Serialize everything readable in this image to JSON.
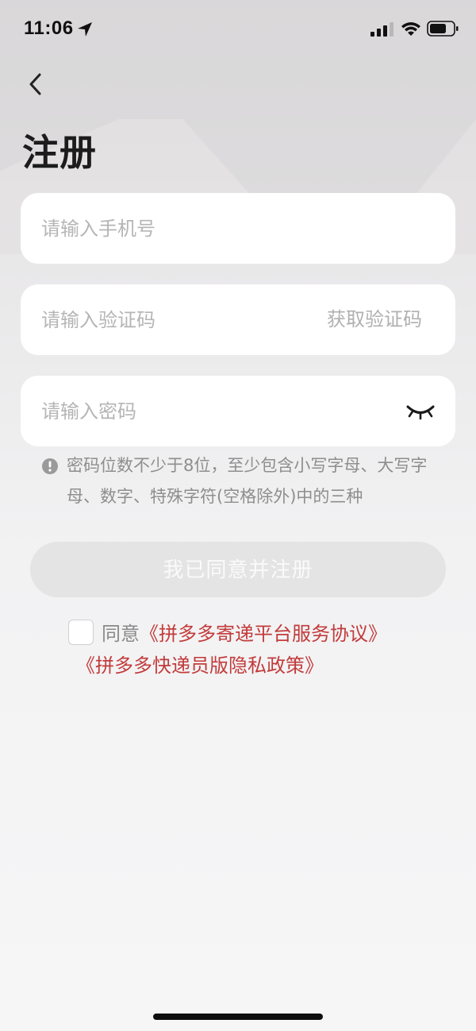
{
  "status_bar": {
    "time": "11:06"
  },
  "page": {
    "title": "注册"
  },
  "form": {
    "phone_placeholder": "请输入手机号",
    "code_placeholder": "请输入验证码",
    "get_code_label": "获取验证码",
    "password_placeholder": "请输入密码",
    "password_hint": "密码位数不少于8位，至少包含小写字母、大写字母、数字、特殊字符(空格除外)中的三种",
    "register_label": "我已同意并注册"
  },
  "agreement": {
    "prefix": "同意",
    "link_service": "《拼多多寄递平台服务协议》",
    "link_privacy": "《拼多多快递员版隐私政策》"
  },
  "colors": {
    "accent_link": "#c23b3b",
    "disabled_button": "#e4e4e4",
    "hint_text": "#8e8e8e"
  },
  "icons": {
    "back": "chevron-left-icon",
    "location": "location-arrow-icon",
    "signal": "signal-icon",
    "wifi": "wifi-icon",
    "battery": "battery-icon",
    "eye_closed": "eye-closed-icon",
    "info": "info-icon"
  }
}
